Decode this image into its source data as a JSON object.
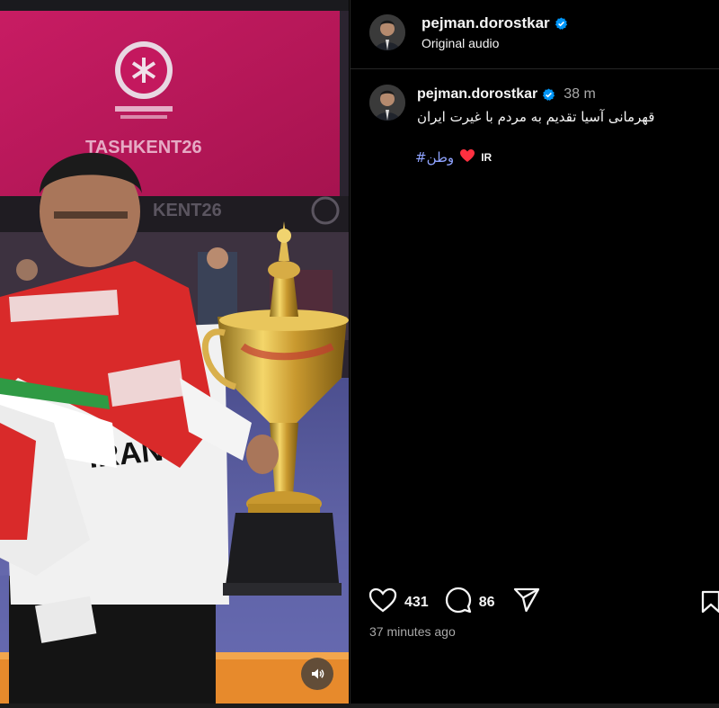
{
  "post": {
    "username": "pejman.dorostkar",
    "audio_label": "Original audio"
  },
  "caption": {
    "username": "pejman.dorostkar",
    "time_ago": "38 m",
    "text": "قهرمانی آسیا تقدیم به مردم با غیرت ایران",
    "hashtag": "#وطن",
    "flag_text": "IR"
  },
  "media_text": {
    "banner": "TASHKENT26",
    "board": "KENT26",
    "shirt": "IRAN"
  },
  "actions": {
    "likes": "431",
    "comments": "86"
  },
  "timestamp": "37 minutes ago",
  "icons": {
    "verified": "verified-badge-icon",
    "heart_emoji": "red-heart-icon",
    "like": "heart-icon",
    "comment": "comment-icon",
    "share": "share-icon",
    "save": "bookmark-icon",
    "sound": "speaker-icon"
  },
  "colors": {
    "background": "#000000",
    "text": "#f5f5f5",
    "secondary_text": "#a8a8a8",
    "hashtag": "#8fa3ff",
    "verified": "#0095f6",
    "heart": "#ff3040"
  }
}
